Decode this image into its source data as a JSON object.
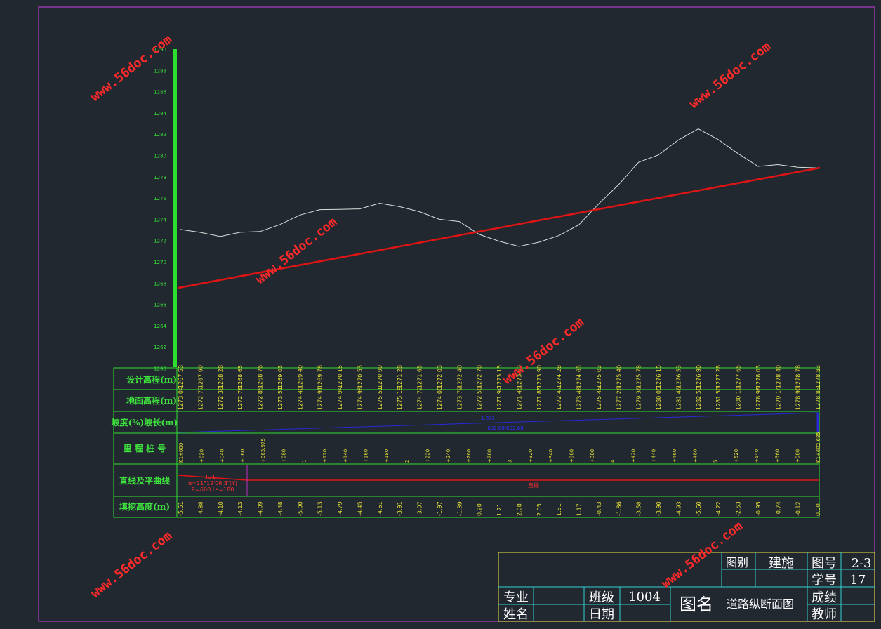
{
  "y_axis": {
    "labels": [
      "1290",
      "1288",
      "1286",
      "1284",
      "1282",
      "1280",
      "1278",
      "1276",
      "1274",
      "1272",
      "1270",
      "1268",
      "1266",
      "1264",
      "1262",
      "1260"
    ]
  },
  "rows": {
    "design_elev": "设计高程(m)",
    "ground_elev": "地面高程(m)",
    "slope": "坡度(%)坡长(m)",
    "station": "里 程 桩 号",
    "alignment": "直线及平曲线",
    "fill_cut": "填挖高度(m)"
  },
  "design_values": [
    "1267.53",
    "1267.90",
    "1268.28",
    "1268.65",
    "1268.76",
    "1269.03",
    "1269.40",
    "1269.78",
    "1270.15",
    "1270.53",
    "1270.90",
    "1271.28",
    "1271.65",
    "1272.03",
    "1272.40",
    "1272.78",
    "1273.15",
    "1273.53",
    "1273.90",
    "1274.28",
    "1274.65",
    "1275.03",
    "1275.40",
    "1275.78",
    "1276.15",
    "1276.53",
    "1276.90",
    "1277.28",
    "1277.65",
    "1278.03",
    "1278.40",
    "1278.78",
    "1278.83"
  ],
  "ground_values": [
    "1273.04",
    "1272.77",
    "1272.38",
    "1272.78",
    "1272.85",
    "1273.51",
    "1274.40",
    "1274.91",
    "1274.94",
    "1274.98",
    "1275.51",
    "1275.19",
    "1274.72",
    "1274.00",
    "1273.79",
    "1272.58",
    "1271.94",
    "1271.45",
    "1271.85",
    "1272.47",
    "1273.48",
    "1275.46",
    "1277.26",
    "1279.36",
    "1280.05",
    "1281.46",
    "1282.50",
    "1281.50",
    "1280.18",
    "1278.98",
    "1279.14",
    "1278.90",
    "1278.83"
  ],
  "fill_values": [
    "-5.51",
    "-4.88",
    "-4.10",
    "-4.13",
    "-4.09",
    "-4.48",
    "-5.00",
    "-5.13",
    "-4.79",
    "-4.45",
    "-4.61",
    "-3.91",
    "-3.07",
    "-1.97",
    "-1.39",
    "0.20",
    "1.21",
    "2.08",
    "2.05",
    "1.81",
    "1.17",
    "-0.43",
    "-1.86",
    "-3.58",
    "-3.90",
    "-4.93",
    "-5.60",
    "-4.22",
    "-2.53",
    "-0.95",
    "-0.74",
    "-0.12",
    "0.00"
  ],
  "station_values": [
    "K1+000",
    "+020",
    "+040",
    "+060",
    "+063.975",
    "+080",
    "1",
    "+120",
    "+140",
    "+160",
    "+180",
    "2",
    "+220",
    "+240",
    "+260",
    "+280",
    "3",
    "+320",
    "+340",
    "+360",
    "+380",
    "4",
    "+420",
    "+440",
    "+460",
    "+480",
    "5",
    "+520",
    "+540",
    "+560",
    "+580",
    "K1+602.685"
  ],
  "slope_text": "1.872",
  "slope_len": "602.68/602.68",
  "curve_label": "JD1",
  "curve_detail1": "α=21°12′06.3″(Y)",
  "curve_detail2": "R=600  Ls=180",
  "line_label": "直线",
  "watermark": "www.56doc.com",
  "title_block": {
    "fig_type_label": "图别",
    "fig_type": "建施",
    "fig_no_label": "图号",
    "fig_no": "2-3",
    "student_no_label": "学号",
    "student_no": "17",
    "major_label": "专业",
    "class_label": "班级",
    "class_value": "1004",
    "title_label": "图名",
    "title_value": "道路纵断面图",
    "grade_label": "成绩",
    "name_label": "姓名",
    "date_label": "日期",
    "teacher_label": "教师"
  },
  "colors": {
    "frame": "#b03cc8",
    "grid": "#2ee02e",
    "ground": "#dcdcdc",
    "design": "#e01414",
    "text_yellow": "#e6e236",
    "title_frame": "#e8e23c",
    "title_grid": "#35d0d0"
  }
}
